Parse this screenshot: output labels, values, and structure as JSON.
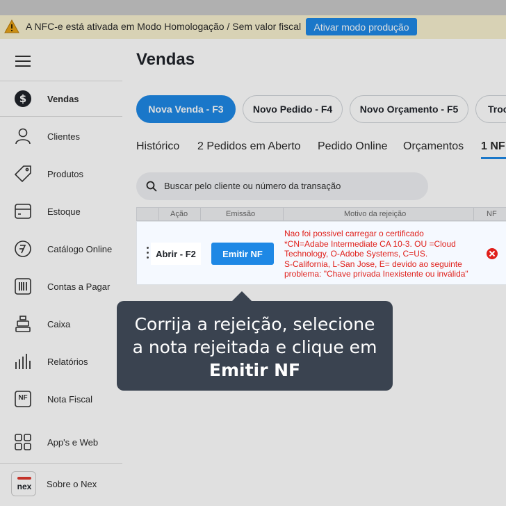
{
  "banner": {
    "text": "A NFC-e está ativada em Modo Homologação / Sem valor fiscal",
    "button": "Ativar modo produção"
  },
  "sidebar": {
    "items": [
      {
        "label": "Vendas",
        "icon": "dollar-icon"
      },
      {
        "label": "Clientes",
        "icon": "user-icon"
      },
      {
        "label": "Produtos",
        "icon": "tag-icon"
      },
      {
        "label": "Estoque",
        "icon": "box-icon"
      },
      {
        "label": "Catálogo Online",
        "icon": "catalog-icon"
      },
      {
        "label": "Contas a Pagar",
        "icon": "barcode-icon"
      },
      {
        "label": "Caixa",
        "icon": "register-icon"
      },
      {
        "label": "Relatórios",
        "icon": "bars-icon"
      },
      {
        "label": "Nota Fiscal",
        "icon": "nf-icon"
      },
      {
        "label": "App's e Web",
        "icon": "grid-icon"
      },
      {
        "label": "Sobre o Nex",
        "icon": "nex-logo"
      }
    ],
    "nf_badge": "NF",
    "nex_text": "nex"
  },
  "main": {
    "title": "Vendas",
    "pills": [
      "Nova Venda - F3",
      "Novo Pedido - F4",
      "Novo Orçamento - F5",
      "Troc"
    ],
    "tabs": [
      "Histórico",
      "2 Pedidos em Aberto",
      "Pedido Online",
      "Orçamentos",
      "1 NF"
    ],
    "search_placeholder": "Buscar pelo cliente ou número da transação",
    "columns": [
      "Ação",
      "Emissão",
      "Motivo da rejeição",
      "NF"
    ],
    "row": {
      "open_label": "Abrir - F2",
      "emit_label": "Emitir NF",
      "reject_lines": [
        "Nao foi possivel carregar o certificado",
        "*CN=Adabe Intermediate CA 10-3. OU =Cloud",
        "Technology, O-Adobe Systems, C=US.",
        "S-California, L-San Jose, E= devido ao seguinte",
        "problema: \"Chave privada Inexistente ou inválida\""
      ]
    }
  },
  "tooltip": {
    "line1": "Corrija a rejeição, selecione",
    "line2": "a nota rejeitada e clique em",
    "line3": "Emitir NF"
  },
  "colors": {
    "accent": "#1e88e5",
    "error": "#e0201b",
    "tooltip_bg": "#3a4350"
  }
}
